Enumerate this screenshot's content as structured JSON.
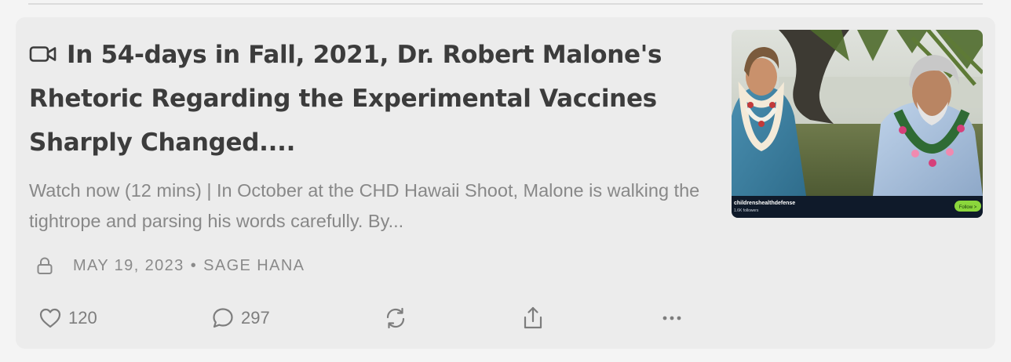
{
  "post": {
    "title": "In 54-days in Fall, 2021, Dr. Robert Malone's Rhetoric Regarding the Experimental Vaccines Sharply Changed....",
    "subtitle": "Watch now (12 mins) | In October at the CHD Hawaii Shoot, Malone is walking the tightrope and parsing his words carefully. By...",
    "date": "MAY 19, 2023",
    "separator": "•",
    "author": "SAGE HANA",
    "type_icon": "video-camera-icon",
    "access_icon": "lock-icon"
  },
  "actions": {
    "likes": "120",
    "comments": "297",
    "like_icon": "heart-icon",
    "comment_icon": "comment-bubble-icon",
    "restack_icon": "restack-arrows-icon",
    "share_icon": "share-icon",
    "more_icon": "more-dots-icon"
  },
  "thumbnail": {
    "channel": "childrenshealthdefense",
    "followers": "1.6K followers",
    "follow_label": "Follow >",
    "follow_color": "#8bd63c"
  },
  "colors": {
    "page_bg": "#f4f4f4",
    "card_bg": "#ececec",
    "title": "#3c3c3c",
    "muted": "#888888"
  }
}
